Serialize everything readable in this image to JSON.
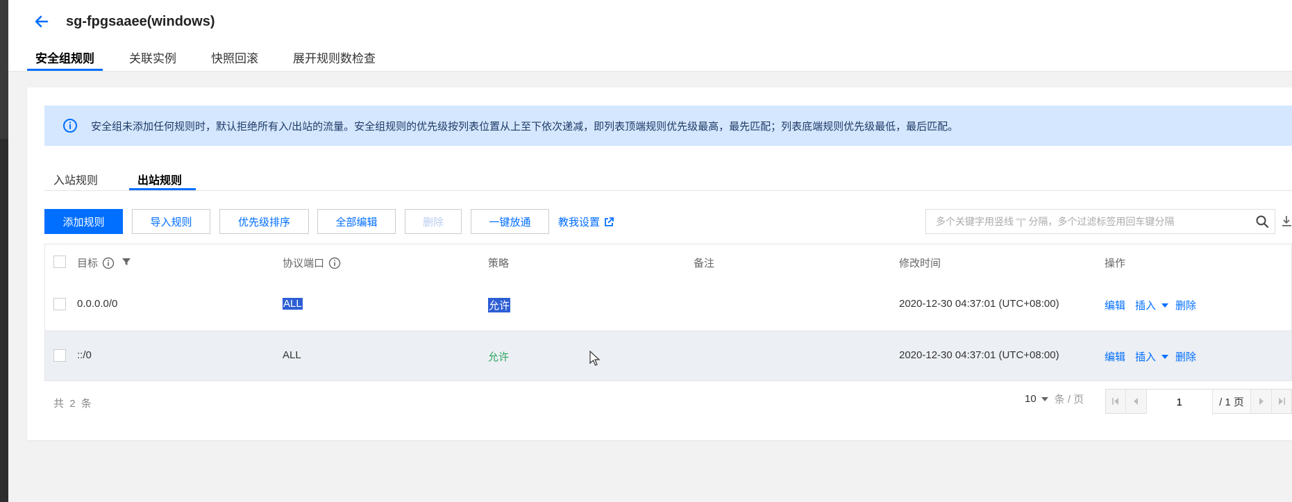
{
  "header": {
    "title": "sg-fpgsaaee(windows)",
    "tabs": [
      "安全组规则",
      "关联实例",
      "快照回滚",
      "展开规则数检查"
    ]
  },
  "info": {
    "text": "安全组未添加任何规则时，默认拒绝所有入/出站的流量。安全组规则的优先级按列表位置从上至下依次递减，即列表顶端规则优先级最高，最先匹配；列表底端规则优先级最低，最后匹配。"
  },
  "sub_tabs": {
    "inbound": "入站规则",
    "outbound": "出站规则"
  },
  "toolbar": {
    "add": "添加规则",
    "import": "导入规则",
    "priority": "优先级排序",
    "edit_all": "全部编辑",
    "delete": "删除",
    "open_all": "一键放通",
    "help": "教我设置",
    "search_placeholder": "多个关键字用竖线 \"|\" 分隔，多个过滤标签用回车键分隔"
  },
  "table": {
    "headers": {
      "target": "目标",
      "protocol": "协议端口",
      "policy": "策略",
      "note": "备注",
      "modified": "修改时间",
      "actions": "操作"
    },
    "rows": [
      {
        "target": "0.0.0.0/0",
        "protocol": "ALL",
        "policy": "允许",
        "note": "",
        "modified": "2020-12-30 04:37:01 (UTC+08:00)"
      },
      {
        "target": "::/0",
        "protocol": "ALL",
        "policy": "允许",
        "note": "",
        "modified": "2020-12-30 04:37:01 (UTC+08:00)"
      }
    ],
    "actions": {
      "edit": "编辑",
      "insert": "插入",
      "delete": "删除"
    }
  },
  "footer": {
    "total_prefix": "共",
    "total": "2",
    "total_suffix": "条",
    "page_size": "10",
    "page_size_unit": "条 / 页",
    "page": "1",
    "page_total": "/ 1 页"
  },
  "colors": {
    "accent": "#006eff",
    "info_bg": "#d5e7ff",
    "allow": "#2da562"
  }
}
